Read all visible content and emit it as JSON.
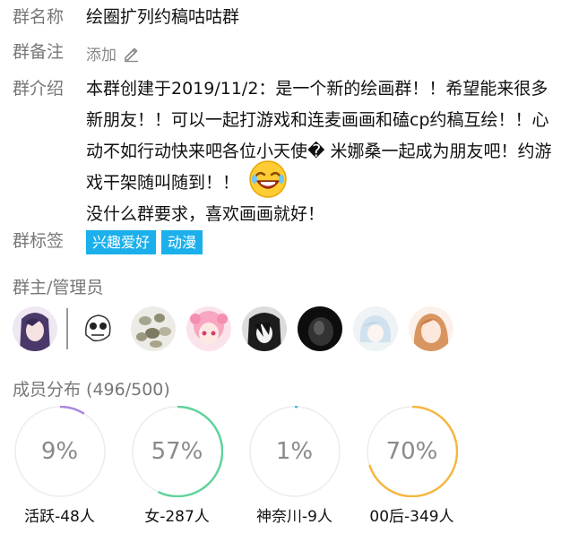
{
  "group_name": {
    "label": "群名称",
    "value": "绘圈扩列约稿咕咕群"
  },
  "group_remark": {
    "label": "群备注",
    "add_label": "添加",
    "icon": "pencil-icon"
  },
  "group_intro": {
    "label": "群介绍",
    "text_part1": "本群创建于2019/11/2：是一个新的绘画群！！希望能来很多新朋友！！可以一起打游戏和连麦画画和磕cp约稿互绘！！心动不如行动快来吧各位小天使� 米娜桑一起成为朋友吧！约游戏干架随叫随到！！",
    "emoji": "laughing-face-emoji",
    "text_part2": "没什么群要求，喜欢画画就好！"
  },
  "group_tags": {
    "label": "群标签",
    "tags": [
      "兴趣爱好",
      "动漫"
    ],
    "tag_color": "#1bb0ec"
  },
  "admins": {
    "title": "群主/管理员",
    "owner_avatar": "anime-girl-purple-avatar",
    "admin_avatars": [
      "ghost-sketch-avatar",
      "stones-avatar",
      "pink-hair-girl-avatar",
      "dark-hair-boy-avatar",
      "dark-figure-avatar",
      "white-hair-avatar",
      "ginger-girl-avatar"
    ]
  },
  "members": {
    "title": "成员分布 (496/500)",
    "stats": [
      {
        "percent_text": "9%",
        "fraction": 0.09,
        "caption": "活跃-48人",
        "color": "#a887e0"
      },
      {
        "percent_text": "57%",
        "fraction": 0.57,
        "caption": "女-287人",
        "color": "#5fd39a"
      },
      {
        "percent_text": "1%",
        "fraction": 0.01,
        "caption": "神奈川-9人",
        "color": "#3ab4f2"
      },
      {
        "percent_text": "70%",
        "fraction": 0.7,
        "caption": "00后-349人",
        "color": "#f6b640"
      }
    ]
  }
}
